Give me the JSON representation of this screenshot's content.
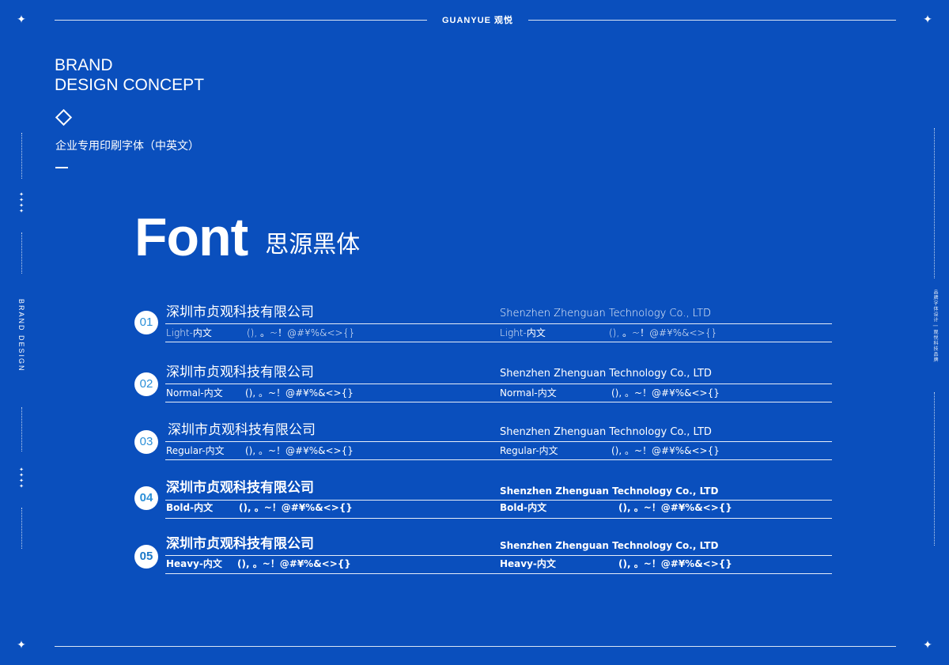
{
  "header": {
    "logo_text": "GUANYUE 观悦"
  },
  "intro": {
    "title_line1": "BRAND",
    "title_line2": "DESIGN CONCEPT",
    "subtitle": "企业专用印刷字体（中英文）"
  },
  "side": {
    "left_label": "BRAND DESIGN",
    "right_label": "品牌字体设计 | 观悦科技品牌"
  },
  "heading": {
    "word": "Font",
    "cn": "思源黑体"
  },
  "rows": [
    {
      "num": "01",
      "cn_name": "深圳市贞观科技有限公司",
      "cn_weight": "Light-内文",
      "punct": "(), 。~！@#¥%&<>{}",
      "en_name": "Shenzhen Zhenguan Technology Co., LTD",
      "en_weight": "Light-内文",
      "en_punct": "(), 。~！@#¥%&<>{}"
    },
    {
      "num": "02",
      "cn_name": "深圳市贞观科技有限公司",
      "cn_weight": "Normal-内文",
      "punct": "(), 。~！@#¥%&<>{}",
      "en_name": "Shenzhen Zhenguan Technology Co., LTD",
      "en_weight": "Normal-内文",
      "en_punct": "(), 。~！@#¥%&<>{}"
    },
    {
      "num": "03",
      "cn_name": "深圳市贞观科技有限公司",
      "cn_weight": "Regular-内文",
      "punct": "(), 。~！@#¥%&<>{}",
      "en_name": "Shenzhen Zhenguan Technology Co., LTD",
      "en_weight": "Regular-内文",
      "en_punct": "(), 。~！@#¥%&<>{}"
    },
    {
      "num": "04",
      "cn_name": "深圳市贞观科技有限公司",
      "cn_weight": "Bold-内文",
      "punct": "(), 。~！@#¥%&<>{}",
      "en_name": "Shenzhen Zhenguan Technology Co., LTD",
      "en_weight": "Bold-内文",
      "en_punct": "(), 。~！@#¥%&<>{}"
    },
    {
      "num": "05",
      "cn_name": "深圳市贞观科技有限公司",
      "cn_weight": "Heavy-内文",
      "punct": "(), 。~！@#¥%&<>{}",
      "en_name": "Shenzhen Zhenguan Technology Co., LTD",
      "en_weight": "Heavy-内文",
      "en_punct": "(), 。~！@#¥%&<>{}"
    }
  ],
  "icons": {
    "corner": "sparkle-icon",
    "diamond": "diamond-icon"
  },
  "colors": {
    "background": "#0a4fbd",
    "number_text": "#2a8fd8",
    "foreground": "#ffffff"
  }
}
